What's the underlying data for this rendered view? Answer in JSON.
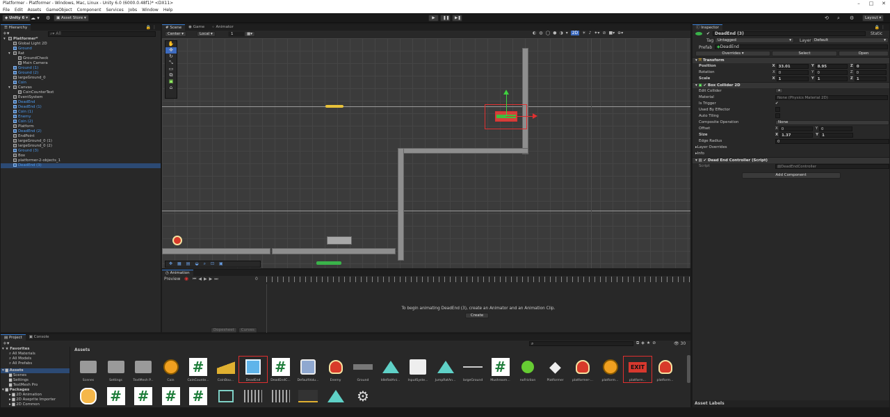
{
  "window_title": "Platformer - Platformer - Windows, Mac, Linux - Unity 6.0 (6000.0.48f1)* <DX11>",
  "menu": [
    "File",
    "Edit",
    "Assets",
    "GameObject",
    "Component",
    "Services",
    "Jobs",
    "Window",
    "Help"
  ],
  "toolbar": {
    "account": "Unity 6",
    "asset_store": "Asset Store",
    "layout": "Layout"
  },
  "hierarchy": {
    "title": "Hierarchy",
    "search_placeholder": "All",
    "items": [
      {
        "label": "Platformer*",
        "indent": 0,
        "color": "white",
        "bold": true
      },
      {
        "label": "Global Light 2D",
        "indent": 1,
        "color": "white"
      },
      {
        "label": "Ground",
        "indent": 1,
        "color": "blue"
      },
      {
        "label": "Rat",
        "indent": 1,
        "color": "white"
      },
      {
        "label": "GroundCheck",
        "indent": 2,
        "color": "white"
      },
      {
        "label": "Main Camera",
        "indent": 2,
        "color": "white"
      },
      {
        "label": "Ground (1)",
        "indent": 1,
        "color": "blue"
      },
      {
        "label": "Ground (2)",
        "indent": 1,
        "color": "blue"
      },
      {
        "label": "largeGround_0",
        "indent": 1,
        "color": "white"
      },
      {
        "label": "Coin",
        "indent": 1,
        "color": "blue"
      },
      {
        "label": "Canvas",
        "indent": 1,
        "color": "white"
      },
      {
        "label": "CoinCounterText",
        "indent": 2,
        "color": "white"
      },
      {
        "label": "EventSystem",
        "indent": 1,
        "color": "white"
      },
      {
        "label": "DeadEnd",
        "indent": 1,
        "color": "blue"
      },
      {
        "label": "DeadEnd (1)",
        "indent": 1,
        "color": "blue"
      },
      {
        "label": "Coin (1)",
        "indent": 1,
        "color": "blue"
      },
      {
        "label": "Enemy",
        "indent": 1,
        "color": "blue"
      },
      {
        "label": "Coin (2)",
        "indent": 1,
        "color": "blue"
      },
      {
        "label": "Platform",
        "indent": 1,
        "color": "white"
      },
      {
        "label": "DeadEnd (2)",
        "indent": 1,
        "color": "blue"
      },
      {
        "label": "EndPoint",
        "indent": 1,
        "color": "white"
      },
      {
        "label": "largeGround_0 (1)",
        "indent": 1,
        "color": "white"
      },
      {
        "label": "largeGround_0 (2)",
        "indent": 1,
        "color": "white"
      },
      {
        "label": "Ground (3)",
        "indent": 1,
        "color": "blue"
      },
      {
        "label": "Box",
        "indent": 1,
        "color": "white"
      },
      {
        "label": "platformer-2-objects_1",
        "indent": 1,
        "color": "white"
      },
      {
        "label": "DeadEnd (3)",
        "indent": 1,
        "color": "blue",
        "selected": true
      }
    ]
  },
  "scene": {
    "tabs": [
      "Scene",
      "Game",
      "Animator"
    ],
    "pivot": "Center",
    "space": "Local",
    "grid_snap": "1"
  },
  "animation": {
    "title": "Animation",
    "preview": "Preview",
    "time": "0",
    "message": "To begin animating DeadEnd (3), create an Animator and an Animation Clip.",
    "create": "Create",
    "tab_dopesheet": "Dopesheet",
    "tab_curves": "Curves"
  },
  "inspector": {
    "title": "Inspector",
    "object_name": "DeadEnd (3)",
    "static": "Static",
    "tag_label": "Tag",
    "tag_value": "Untagged",
    "layer_label": "Layer",
    "layer_value": "Default",
    "prefab_label": "Prefab",
    "prefab_value": "DeadEnd",
    "overrides": "Overrides",
    "select": "Select",
    "open": "Open",
    "transform": {
      "title": "Transform",
      "position_label": "Position",
      "rotation_label": "Rotation",
      "scale_label": "Scale",
      "position": [
        "33.01",
        "8.95",
        "0"
      ],
      "rotation": [
        "0",
        "0",
        "0"
      ],
      "scale": [
        "1",
        "1",
        "1"
      ]
    },
    "box_collider": {
      "title": "Box Collider 2D",
      "edit_collider": "Edit Collider",
      "material": "Material",
      "material_value": "None (Physics Material 2D)",
      "is_trigger": "Is Trigger",
      "used_by_effector": "Used By Effector",
      "auto_tiling": "Auto Tiling",
      "composite": "Composite Operation",
      "composite_value": "None",
      "offset": "Offset",
      "offset_values": [
        "0",
        "0"
      ],
      "size": "Size",
      "size_values": [
        "1.37",
        "1"
      ],
      "edge_radius": "Edge Radius",
      "edge_radius_value": "0",
      "layer_overrides": "Layer Overrides",
      "info": "Info"
    },
    "script_comp": {
      "title": "Dead End Controller (Script)",
      "script_label": "Script",
      "script_value": "DeadEndController"
    },
    "add_component": "Add Component",
    "asset_labels": "Asset Labels"
  },
  "project": {
    "tabs": [
      "Project",
      "Console"
    ],
    "favorites": "Favorites",
    "fav_items": [
      "All Materials",
      "All Models",
      "All Prefabs"
    ],
    "assets_root": "Assets",
    "asset_tree": [
      "Scenes",
      "Settings",
      "TextMesh Pro"
    ],
    "packages": "Packages",
    "package_tree": [
      "2D Animation",
      "2D Aseprite Importer",
      "2D Common"
    ],
    "breadcrumb": "Assets",
    "count": "30",
    "assets_row1": [
      "Scenes",
      "Settings",
      "TextMesh P...",
      "Coin",
      "CoinCounte...",
      "CoinBou...",
      "DeadEnd",
      "DeadEndC...",
      "DefaultVolu...",
      "Enemy",
      "Ground",
      "IdleRatAni...",
      "InputSyste...",
      "JumpRatAn...",
      "largeGround",
      "Mushroom...",
      "noFriction",
      "Platformer",
      "platformer-...",
      "platform...",
      "platform...",
      "platform..."
    ]
  }
}
